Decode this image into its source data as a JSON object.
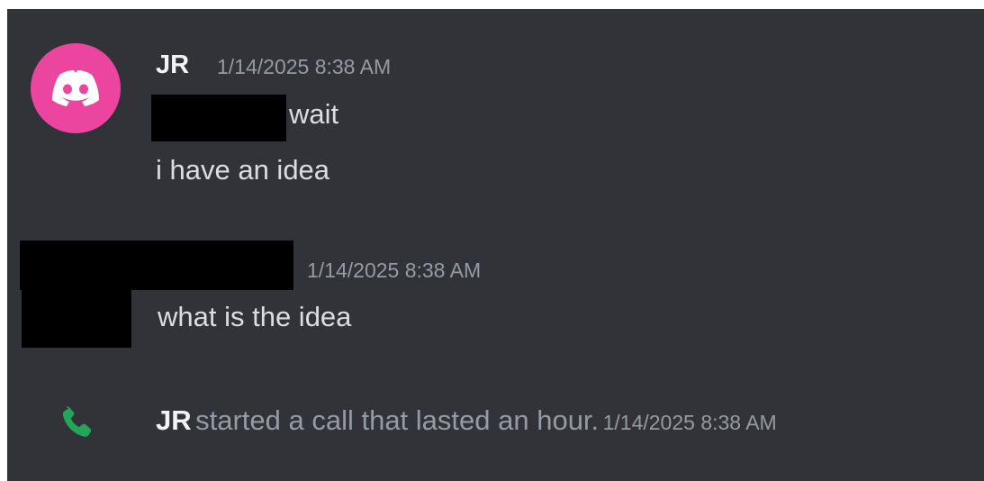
{
  "messages": [
    {
      "author": "JR",
      "timestamp": "1/14/2025 8:38 AM",
      "lines": [
        "wait",
        "i have an idea"
      ]
    },
    {
      "author": "",
      "timestamp": "1/14/2025 8:38 AM",
      "lines": [
        "what is the idea"
      ]
    }
  ],
  "call": {
    "user": "JR",
    "text": "started a call that lasted an hour.",
    "timestamp": "1/14/2025 8:38 AM",
    "icon": "phone-icon",
    "icon_color": "#23a55a"
  },
  "colors": {
    "background": "#313338",
    "avatar": "#eb459f",
    "username": "#f2f3f5",
    "message_text": "#dbdee1",
    "muted": "#949ba4"
  },
  "avatar_icon": "discord-logo-icon"
}
